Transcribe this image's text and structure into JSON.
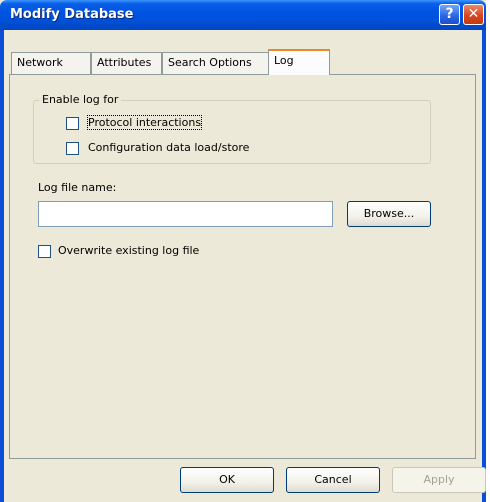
{
  "window": {
    "title": "Modify Database",
    "help_glyph": "?",
    "close_glyph": "✕"
  },
  "tabs": [
    {
      "label": "Network",
      "active": false
    },
    {
      "label": "Attributes",
      "active": false
    },
    {
      "label": "Search Options",
      "active": false
    },
    {
      "label": "Log",
      "active": true
    }
  ],
  "log": {
    "group_label": "Enable log for",
    "protocol_label": "Protocol interactions",
    "protocol_checked": false,
    "config_label": "Configuration data load/store",
    "config_checked": false,
    "file_name_label": "Log file name:",
    "file_name_value": "",
    "browse_label": "Browse...",
    "overwrite_label": "Overwrite existing log file",
    "overwrite_checked": false
  },
  "buttons": {
    "ok": "OK",
    "cancel": "Cancel",
    "apply": "Apply",
    "apply_enabled": false
  },
  "colors": {
    "titlebar": "#0054e3",
    "dialog_bg": "#ece9d8",
    "active_tab_accent": "#e68b2c"
  }
}
